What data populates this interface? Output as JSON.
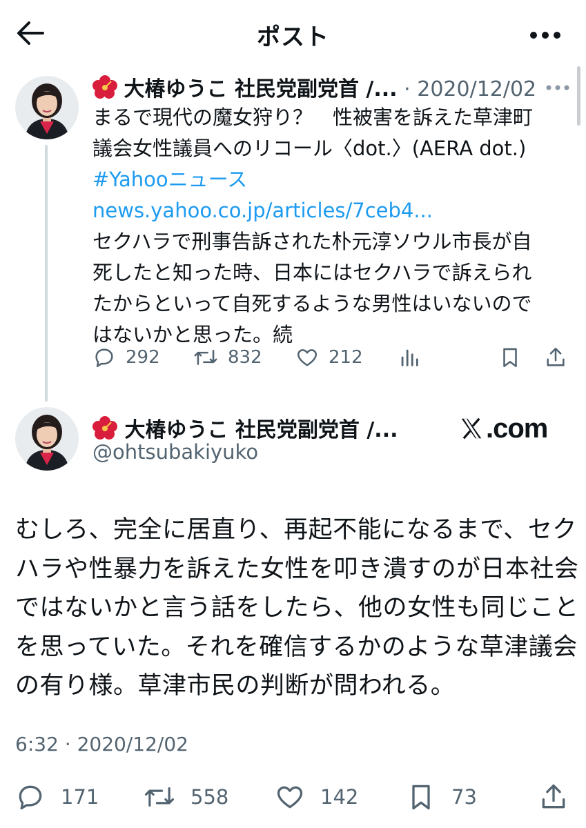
{
  "header": {
    "title": "ポスト"
  },
  "quoted_post": {
    "author_name": "大椿ゆうこ 社民党副党首 /...",
    "separator": "·",
    "date": "2020/12/02",
    "lines": [
      "まるで現代の魔女狩り？　性被害を訴えた草津町",
      "議会女性議員へのリコール〈dot.〉(AERA dot.)"
    ],
    "hashtag": "#Yahooニュース",
    "url": "news.yahoo.co.jp/articles/7ceb4...",
    "lines_after": [
      "セクハラで刑事告訴された朴元淳ソウル市長が自",
      "死したと知った時、日本にはセクハラで訴えられ",
      "たからといって自死するような男性はいないので",
      "はないかと思った。続"
    ],
    "stats": {
      "replies": "292",
      "reposts": "832",
      "likes": "212"
    }
  },
  "main_post": {
    "author_name": "大椿ゆうこ 社民党副党首 /...",
    "handle": "@ohtsubakiyuko",
    "source_label": ".com",
    "lines": [
      "むしろ、完全に居直り、再起不能になるまで、セク",
      "ハラや性暴力を訴えた女性を叩き潰すのが日本社会",
      "ではないかと言う話をしたら、他の女性も同じこと",
      "を思っていた。それを確信するかのような草津議会",
      "の有り様。草津市民の判断が問われる。"
    ],
    "timestamp": "6:32 · 2020/12/02",
    "stats": {
      "replies": "171",
      "reposts": "558",
      "likes": "142",
      "bookmarks": "73"
    }
  },
  "icons": [
    "back-arrow-icon",
    "more-horizontal-icon",
    "hibiscus-icon",
    "reply-icon",
    "repost-icon",
    "like-icon",
    "views-icon",
    "bookmark-icon",
    "share-icon",
    "x-logo-icon"
  ],
  "colors": {
    "text": "#0f1419",
    "secondary": "#536471",
    "link": "#1d9bf0",
    "thread_line": "#cfd9de"
  }
}
